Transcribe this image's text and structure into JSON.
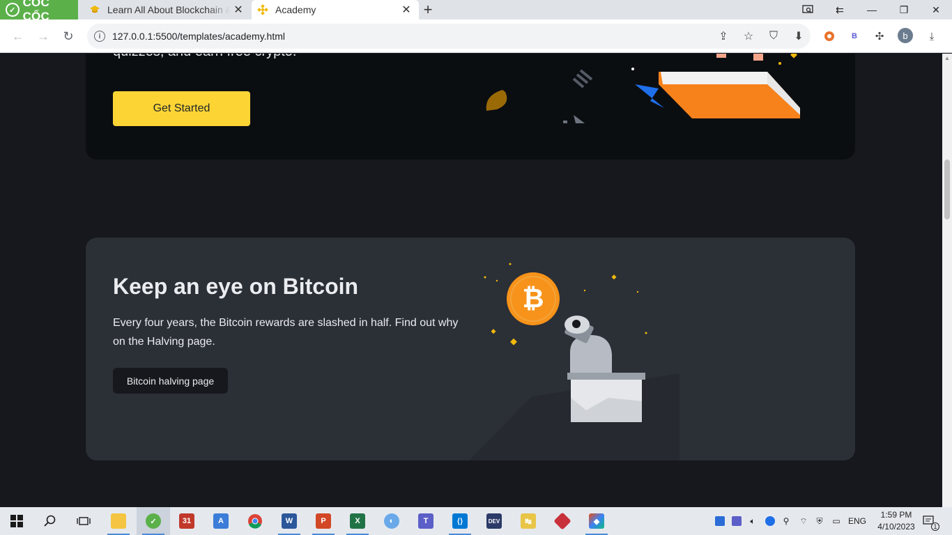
{
  "browser": {
    "brand": "CỐC CỐC",
    "tabs": [
      {
        "title": "Learn All About Blockchain & ",
        "active": false
      },
      {
        "title": "Academy",
        "active": true
      }
    ],
    "new_tab_symbol": "+",
    "url": "127.0.0.1:5500/templates/academy.html",
    "profile_initial": "b"
  },
  "page": {
    "hero": {
      "intro_text": "quizzes, and earn free crypto.",
      "cta_label": "Get Started"
    },
    "bitcoin_card": {
      "heading": "Keep an eye on Bitcoin",
      "description": "Every four years, the Bitcoin rewards are slashed in half. Find out why on the Halving page.",
      "button_label": "Bitcoin halving page",
      "coin_symbol": "₿"
    }
  },
  "taskbar": {
    "language": "ENG",
    "time": "1:59 PM",
    "date": "4/10/2023",
    "notification_count": "1"
  },
  "colors": {
    "accent_yellow": "#fcd535",
    "page_background": "#16181d",
    "hero_card": "#0b0e11",
    "feature_card": "#2b2f36",
    "bitcoin_orange": "#f7931a"
  }
}
